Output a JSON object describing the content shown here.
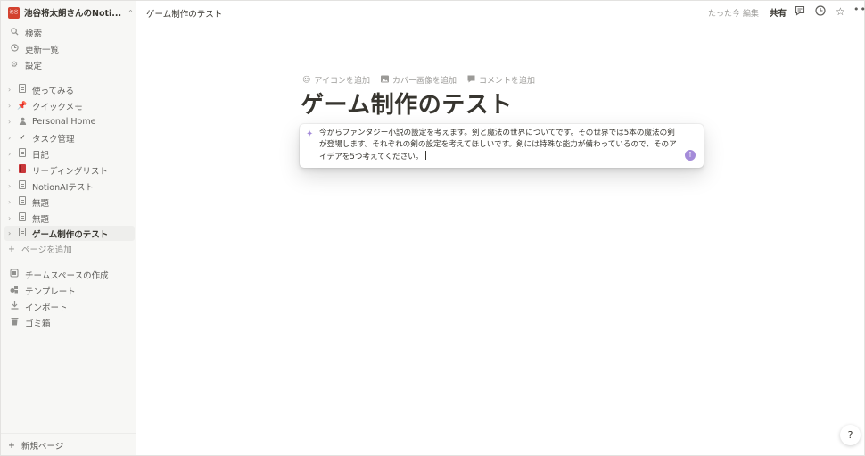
{
  "workspace": {
    "logo_text": "池谷",
    "name": "池谷将太朗さんのNoti..."
  },
  "sidebar": {
    "top_items": [
      {
        "label": "検索",
        "icon": "search-icon"
      },
      {
        "label": "更新一覧",
        "icon": "clock-icon"
      },
      {
        "label": "設定",
        "icon": "gear-icon"
      }
    ],
    "pages": [
      {
        "label": "使ってみる",
        "icon": "document-icon"
      },
      {
        "label": "クイックメモ",
        "icon": "pushpin-icon"
      },
      {
        "label": "Personal Home",
        "icon": "person-icon"
      },
      {
        "label": "タスク管理",
        "icon": "checkmark-icon"
      },
      {
        "label": "日記",
        "icon": "document-icon"
      },
      {
        "label": "リーディングリスト",
        "icon": "book-icon"
      },
      {
        "label": "NotionAIテスト",
        "icon": "document-icon"
      },
      {
        "label": "無題",
        "icon": "document-icon"
      },
      {
        "label": "無題",
        "icon": "document-icon"
      },
      {
        "label": "ゲーム制作のテスト",
        "icon": "document-icon"
      }
    ],
    "add_page": "ページを追加",
    "bottom_items": [
      {
        "label": "チームスペースの作成",
        "icon": "teamspace-icon"
      },
      {
        "label": "テンプレート",
        "icon": "shapes-icon"
      },
      {
        "label": "インポート",
        "icon": "download-icon"
      },
      {
        "label": "ゴミ箱",
        "icon": "trash-icon"
      }
    ],
    "new_page": "新規ページ"
  },
  "topbar": {
    "breadcrumb": "ゲーム制作のテスト",
    "edited": "たった今 編集",
    "share": "共有"
  },
  "page": {
    "actions": {
      "icon": "アイコンを追加",
      "cover": "カバー画像を追加",
      "comment": "コメントを追加"
    },
    "title": "ゲーム制作のテスト",
    "ai_prompt": "今からファンタジー小説の設定を考えます。剣と魔法の世界についてです。その世界では5本の魔法の剣が登場します。それぞれの剣の設定を考えてほしいです。剣には特殊な能力が備わっているので、そのアイデアを5つ考えてください。"
  },
  "help": "?",
  "colors": {
    "accent": "#a48bd9",
    "sidebar_bg": "#f7f7f5",
    "logo": "#d3422f"
  }
}
